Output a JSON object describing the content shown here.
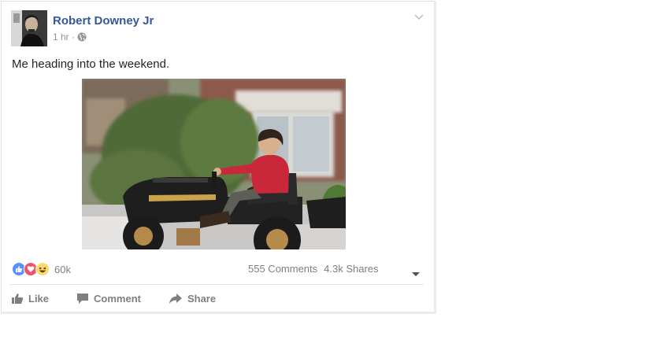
{
  "post": {
    "author": "Robert Downey Jr",
    "time": "1 hr",
    "separator": "·",
    "audience_icon": "globe-icon",
    "options_icon": "chevron-down-icon",
    "text": "Me heading into the weekend."
  },
  "stats": {
    "reactions": [
      "like-reaction-icon",
      "love-reaction-icon",
      "haha-reaction-icon"
    ],
    "reaction_count": "60k",
    "comments": "555 Comments",
    "shares": "4.3k Shares"
  },
  "actions": {
    "like": "Like",
    "comment": "Comment",
    "share": "Share"
  },
  "colors": {
    "link": "#365899",
    "muted": "#90949c",
    "like_blue": "#5890ff",
    "love_red": "#f25268",
    "haha_yellow": "#fcd96b"
  }
}
